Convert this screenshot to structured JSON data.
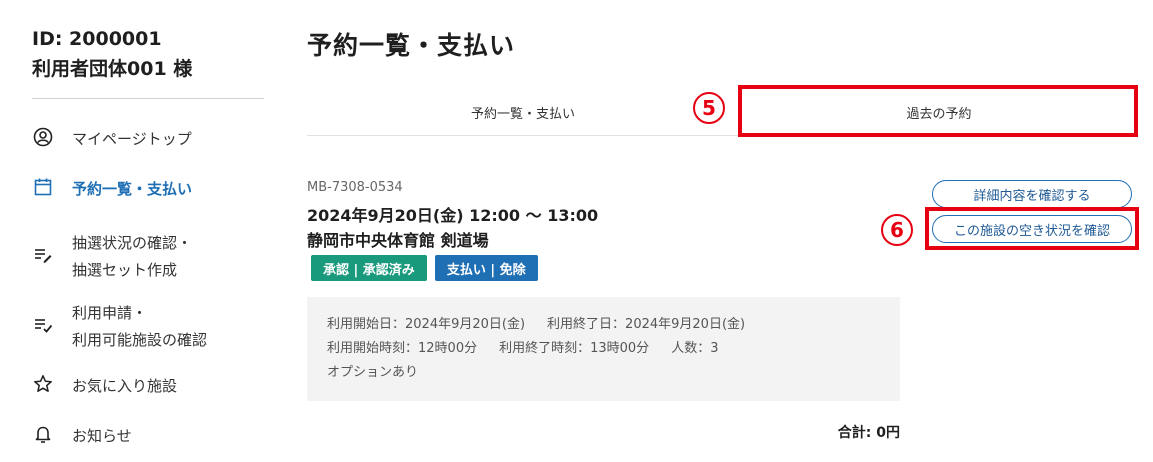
{
  "user": {
    "id": "ID: 2000001",
    "name": "利用者団体001  様"
  },
  "nav": {
    "items": [
      {
        "icon": "user-circle-icon",
        "label_lines": [
          "マイページトップ"
        ]
      },
      {
        "icon": "calendar-icon",
        "label_lines": [
          "予約一覧・支払い"
        ],
        "active": true
      },
      {
        "icon": "edit-list-icon",
        "label_lines": [
          "抽選状況の確認・",
          "抽選セット作成"
        ]
      },
      {
        "icon": "check-list-icon",
        "label_lines": [
          "利用申請・",
          "利用可能施設の確認"
        ]
      },
      {
        "icon": "star-icon",
        "label_lines": [
          "お気に入り施設"
        ]
      },
      {
        "icon": "bell-icon",
        "label_lines": [
          "お知らせ"
        ]
      }
    ]
  },
  "page": {
    "title": "予約一覧・支払い"
  },
  "tabs": {
    "current": "予約一覧・支払い",
    "past": "過去の予約"
  },
  "steps": {
    "tab_step": "5",
    "button_step": "6"
  },
  "reservation": {
    "code": "MB-7308-0534",
    "datetime": "2024年9月20日(金) 12:00 〜 13:00",
    "facility": "静岡市中央体育館 剣道場",
    "badge_approval": "承認 | 承認済み",
    "badge_payment": "支払い | 免除",
    "details": {
      "start_date": "利用開始日：2024年9月20日(金)",
      "end_date": "利用終了日：2024年9月20日(金)",
      "start_time": "利用開始時刻：12時00分",
      "end_time": "利用終了時刻：13時00分",
      "people": "人数：3",
      "options": "オプションあり"
    },
    "total": "合計: 0円",
    "detail_button": "詳細内容を確認する",
    "availability_button": "この施設の空き状況を確認"
  },
  "colors": {
    "accent": "#1f6fb5",
    "highlight": "#e60012",
    "badge_approve": "#1a9a7d",
    "badge_pay": "#1f6fb5"
  }
}
